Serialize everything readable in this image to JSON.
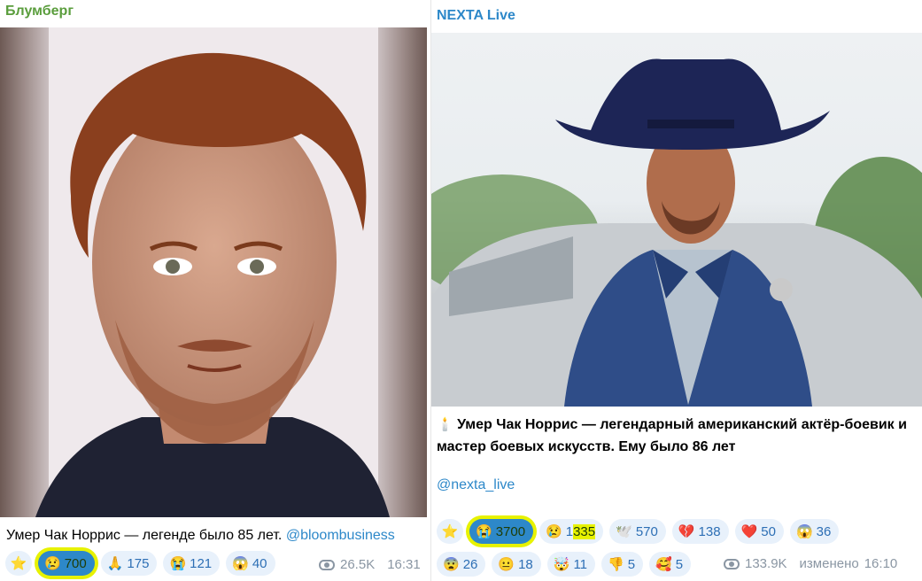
{
  "left_post": {
    "channel": "Блумберг",
    "caption": "Умер Чак Норрис — легенде было 85 лет.",
    "handle": "@bloombusiness",
    "reactions": [
      {
        "icon": "star-icon",
        "glyph": "⭐",
        "count": ""
      },
      {
        "icon": "sad-face-icon",
        "glyph": "😢",
        "count": "700",
        "highlighted": true
      },
      {
        "icon": "praying-hands-icon",
        "glyph": "🙏",
        "count": "175"
      },
      {
        "icon": "crying-face-icon",
        "glyph": "😭",
        "count": "121"
      },
      {
        "icon": "screaming-face-icon",
        "glyph": "😱",
        "count": "40"
      }
    ],
    "views": "26.5K",
    "time": "16:31"
  },
  "right_post": {
    "channel": "NEXTA Live",
    "caption_icon": "🕯️",
    "caption": "Умер Чак Норрис — легендарный американский актёр-боевик и мастер боевых искусств. Ему было 86 лет",
    "handle": "@nexta_live",
    "reactions": [
      {
        "icon": "star-icon",
        "glyph": "⭐",
        "count": ""
      },
      {
        "icon": "crying-face-icon",
        "glyph": "😭",
        "count": "3700",
        "highlighted": true
      },
      {
        "icon": "sad-face-icon",
        "glyph": "😢",
        "count_prefix": "1",
        "count_highlight": "335"
      },
      {
        "icon": "dove-icon",
        "glyph": "🕊️",
        "count": "570"
      },
      {
        "icon": "broken-heart-icon",
        "glyph": "💔",
        "count": "138"
      },
      {
        "icon": "heart-icon",
        "glyph": "❤️",
        "count": "50"
      },
      {
        "icon": "screaming-face-icon",
        "glyph": "😱",
        "count": "36"
      },
      {
        "icon": "fearful-face-icon",
        "glyph": "😨",
        "count": "26"
      },
      {
        "icon": "neutral-face-icon",
        "glyph": "😐",
        "count": "18"
      },
      {
        "icon": "exploding-head-icon",
        "glyph": "🤯",
        "count": "11"
      },
      {
        "icon": "thumbs-down-icon",
        "glyph": "👎",
        "count": "5"
      },
      {
        "icon": "smiling-face-hearts-icon",
        "glyph": "🥰",
        "count": "5"
      }
    ],
    "views": "133.9K",
    "edited": "изменено",
    "time": "16:10"
  },
  "colors": {
    "left_channel": "#5a9d3c",
    "right_channel": "#2d88c9",
    "chip_bg": "#e8f1fb",
    "chip_text": "#2d6fb5",
    "highlight_marker": "#e7f200"
  }
}
